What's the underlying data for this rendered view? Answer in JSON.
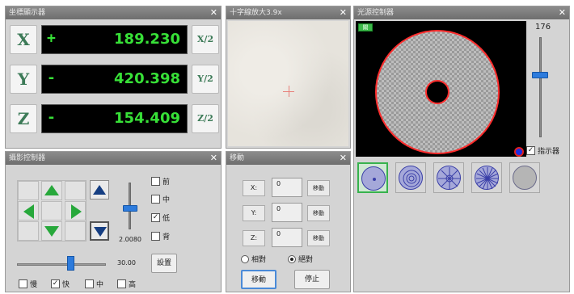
{
  "dro_panel": {
    "title": "坐標顯示器",
    "rows": [
      {
        "axis": "X",
        "sign": "+",
        "value": "189.230",
        "half": "X/2"
      },
      {
        "axis": "Y",
        "sign": "-",
        "value": "420.398",
        "half": "Y/2"
      },
      {
        "axis": "Z",
        "sign": "-",
        "value": "154.409",
        "half": "Z/2"
      }
    ]
  },
  "view_panel": {
    "title": "十字線放大3.9x"
  },
  "light_panel": {
    "title": "光源控制器",
    "tag": "關",
    "intensity": "176",
    "intensity_level": 0.62,
    "checkbox_label": "指示器",
    "checkbox_checked": true,
    "patterns": [
      "center-dot",
      "rings",
      "sectors-8",
      "sectors-16",
      "full"
    ]
  },
  "camera_panel": {
    "title": "攝影控制器",
    "checkboxes": [
      {
        "label": "前",
        "checked": false
      },
      {
        "label": "中",
        "checked": false
      },
      {
        "label": "低",
        "checked": true
      },
      {
        "label": "背",
        "checked": false
      }
    ],
    "zoom_value": "2.0080",
    "zoom_level": 0.45,
    "speed_value": "30.00",
    "speed_level": 0.6,
    "settings_label": "設置",
    "bottom_checks": [
      {
        "label": "慢",
        "checked": false
      },
      {
        "label": "快",
        "checked": true
      },
      {
        "label": "中",
        "checked": false
      },
      {
        "label": "高",
        "checked": false
      }
    ]
  },
  "move_panel": {
    "title": "移動",
    "fields": [
      {
        "label": "X:",
        "value": "0",
        "button": "移動"
      },
      {
        "label": "Y:",
        "value": "0",
        "button": "移動"
      },
      {
        "label": "Z:",
        "value": "0",
        "button": "移動"
      }
    ],
    "radio_relative": "相對",
    "radio_absolute": "絕對",
    "selected": "absolute",
    "move_button": "移動",
    "stop_button": "停止"
  },
  "colors": {
    "dro_text": "#37e037",
    "ring_border": "#ff2d2d",
    "slider_thumb": "#2d7bdc",
    "arrow_green": "#27a83b"
  }
}
